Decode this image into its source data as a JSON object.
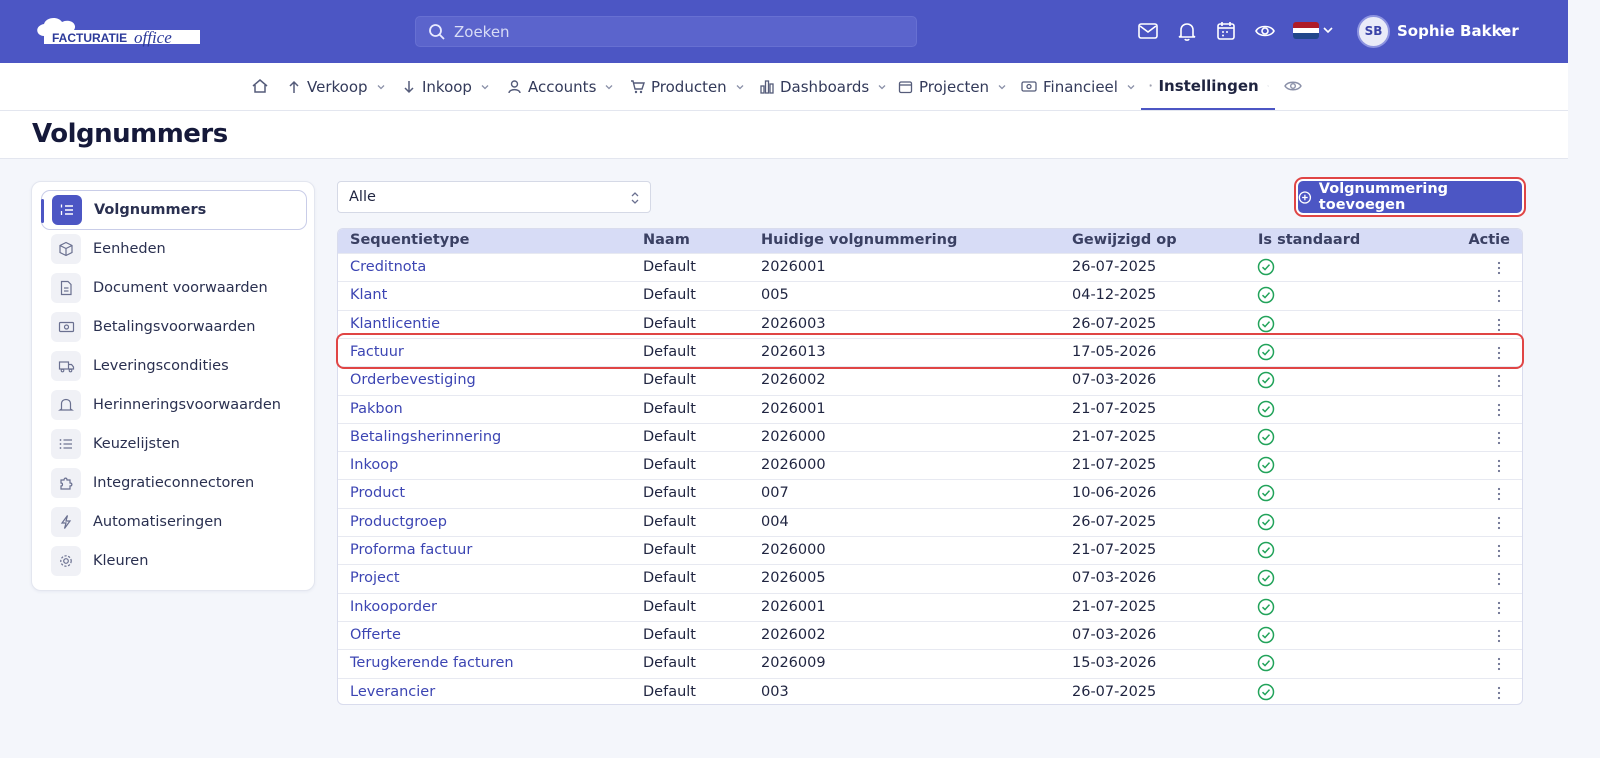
{
  "brand": {
    "logo_text": "FACTURATIEoffice",
    "primary_color": "#4c56c4"
  },
  "search": {
    "placeholder": "Zoeken"
  },
  "topbar_icons": [
    "mail-icon",
    "bell-icon",
    "calendar-icon",
    "eye-icon"
  ],
  "language": {
    "flag": "NL"
  },
  "user": {
    "initials": "SB",
    "name": "Sophie Bakker"
  },
  "nav": {
    "items": [
      {
        "label": "Verkoop",
        "icon": "arrow-up-icon"
      },
      {
        "label": "Inkoop",
        "icon": "arrow-down-icon"
      },
      {
        "label": "Accounts",
        "icon": "user-icon"
      },
      {
        "label": "Producten",
        "icon": "cart-icon"
      },
      {
        "label": "Dashboards",
        "icon": "bar-chart-icon"
      },
      {
        "label": "Projecten",
        "icon": "calendar-icon"
      },
      {
        "label": "Financieel",
        "icon": "money-icon"
      },
      {
        "label": "Instellingen",
        "icon": "gear-icon",
        "active": true
      }
    ]
  },
  "page": {
    "title": "Volgnummers"
  },
  "sidebar": {
    "items": [
      {
        "label": "Volgnummers",
        "active": true
      },
      {
        "label": "Eenheden"
      },
      {
        "label": "Document voorwaarden"
      },
      {
        "label": "Betalingsvoorwaarden"
      },
      {
        "label": "Leveringscondities"
      },
      {
        "label": "Herinneringsvoorwaarden"
      },
      {
        "label": "Keuzelijsten"
      },
      {
        "label": "Integratieconnectoren"
      },
      {
        "label": "Automatiseringen"
      },
      {
        "label": "Kleuren"
      }
    ]
  },
  "filter": {
    "selected": "Alle"
  },
  "add_button": {
    "label": "Volgnummering toevoegen"
  },
  "table": {
    "headers": {
      "sequentietype": "Sequentietype",
      "naam": "Naam",
      "huidige": "Huidige volgnummering",
      "gewijzigd": "Gewijzigd op",
      "standaard": "Is standaard",
      "actie": "Actie"
    },
    "rows": [
      {
        "type": "Creditnota",
        "naam": "Default",
        "huidige": "2026001",
        "gewijzigd": "26-07-2025",
        "standaard": true
      },
      {
        "type": "Klant",
        "naam": "Default",
        "huidige": "005",
        "gewijzigd": "04-12-2025",
        "standaard": true
      },
      {
        "type": "Klantlicentie",
        "naam": "Default",
        "huidige": "2026003",
        "gewijzigd": "26-07-2025",
        "standaard": true
      },
      {
        "type": "Factuur",
        "naam": "Default",
        "huidige": "2026013",
        "gewijzigd": "17-05-2026",
        "standaard": true,
        "highlighted": true
      },
      {
        "type": "Orderbevestiging",
        "naam": "Default",
        "huidige": "2026002",
        "gewijzigd": "07-03-2026",
        "standaard": true
      },
      {
        "type": "Pakbon",
        "naam": "Default",
        "huidige": "2026001",
        "gewijzigd": "21-07-2025",
        "standaard": true
      },
      {
        "type": "Betalingsherinnering",
        "naam": "Default",
        "huidige": "2026000",
        "gewijzigd": "21-07-2025",
        "standaard": true
      },
      {
        "type": "Inkoop",
        "naam": "Default",
        "huidige": "2026000",
        "gewijzigd": "21-07-2025",
        "standaard": true
      },
      {
        "type": "Product",
        "naam": "Default",
        "huidige": "007",
        "gewijzigd": "10-06-2026",
        "standaard": true
      },
      {
        "type": "Productgroep",
        "naam": "Default",
        "huidige": "004",
        "gewijzigd": "26-07-2025",
        "standaard": true
      },
      {
        "type": "Proforma factuur",
        "naam": "Default",
        "huidige": "2026000",
        "gewijzigd": "21-07-2025",
        "standaard": true
      },
      {
        "type": "Project",
        "naam": "Default",
        "huidige": "2026005",
        "gewijzigd": "07-03-2026",
        "standaard": true
      },
      {
        "type": "Inkooporder",
        "naam": "Default",
        "huidige": "2026001",
        "gewijzigd": "21-07-2025",
        "standaard": true
      },
      {
        "type": "Offerte",
        "naam": "Default",
        "huidige": "2026002",
        "gewijzigd": "07-03-2026",
        "standaard": true
      },
      {
        "type": "Terugkerende facturen",
        "naam": "Default",
        "huidige": "2026009",
        "gewijzigd": "15-03-2026",
        "standaard": true
      },
      {
        "type": "Leverancier",
        "naam": "Default",
        "huidige": "003",
        "gewijzigd": "26-07-2025",
        "standaard": true
      }
    ]
  }
}
